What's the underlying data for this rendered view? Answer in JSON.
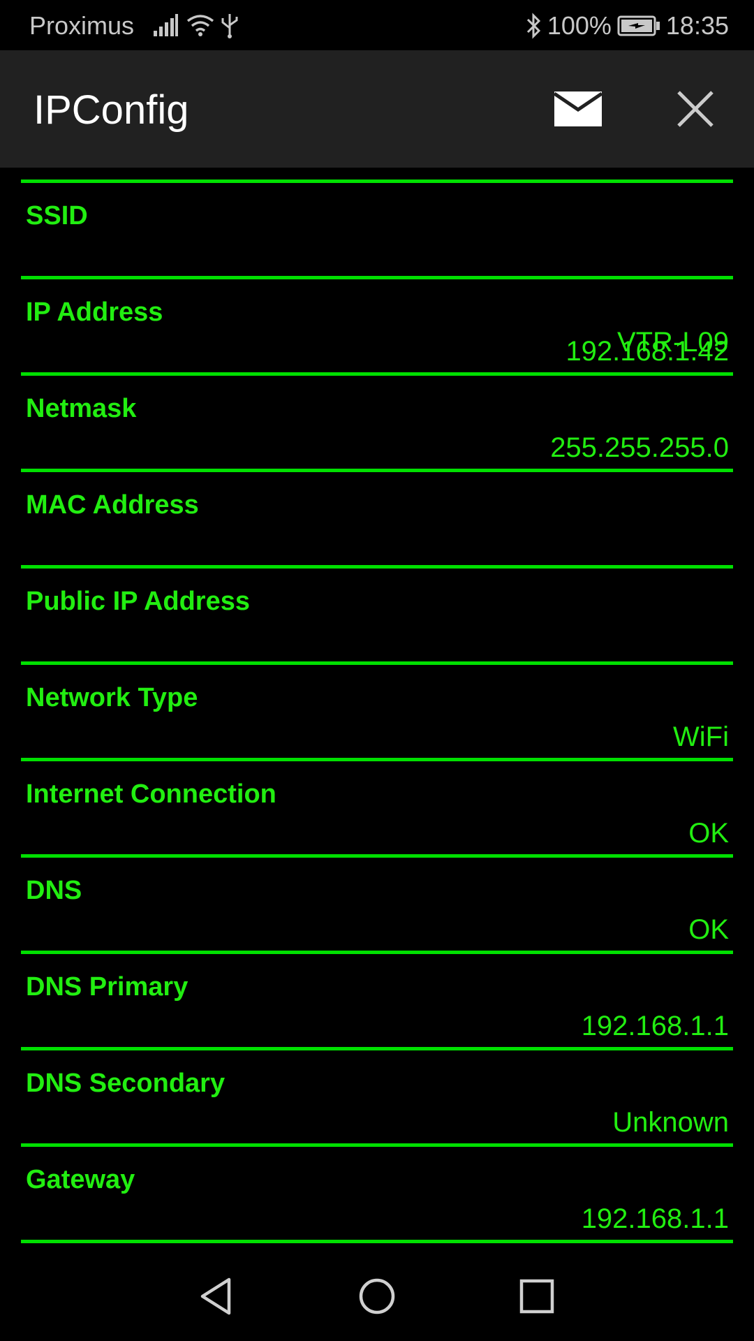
{
  "status_bar": {
    "carrier": "Proximus",
    "battery": "100%",
    "time": "18:35",
    "icons": [
      "signal-icon",
      "wifi-icon",
      "usb-icon",
      "bluetooth-icon",
      "battery-charging-icon"
    ]
  },
  "app_bar": {
    "title": "IPConfig",
    "icons": [
      "mail-icon",
      "close-icon"
    ]
  },
  "list": {
    "partial_top_value": "VTR-L09",
    "rows": [
      {
        "label": "SSID",
        "value": ""
      },
      {
        "label": "IP Address",
        "value": "192.168.1.42"
      },
      {
        "label": "Netmask",
        "value": "255.255.255.0"
      },
      {
        "label": "MAC Address",
        "value": ""
      },
      {
        "label": "Public IP Address",
        "value": ""
      },
      {
        "label": "Network Type",
        "value": "WiFi"
      },
      {
        "label": "Internet Connection",
        "value": "OK"
      },
      {
        "label": "DNS",
        "value": "OK"
      },
      {
        "label": "DNS Primary",
        "value": "192.168.1.1"
      },
      {
        "label": "DNS Secondary",
        "value": "Unknown"
      },
      {
        "label": "Gateway",
        "value": "192.168.1.1"
      }
    ]
  },
  "nav_bar": {
    "icons": [
      "back-icon",
      "home-icon",
      "recents-icon"
    ]
  },
  "colors": {
    "accent_green": "#22ee11",
    "divider_green": "#00e000",
    "app_bar_bg": "#212121",
    "background": "#000000"
  }
}
